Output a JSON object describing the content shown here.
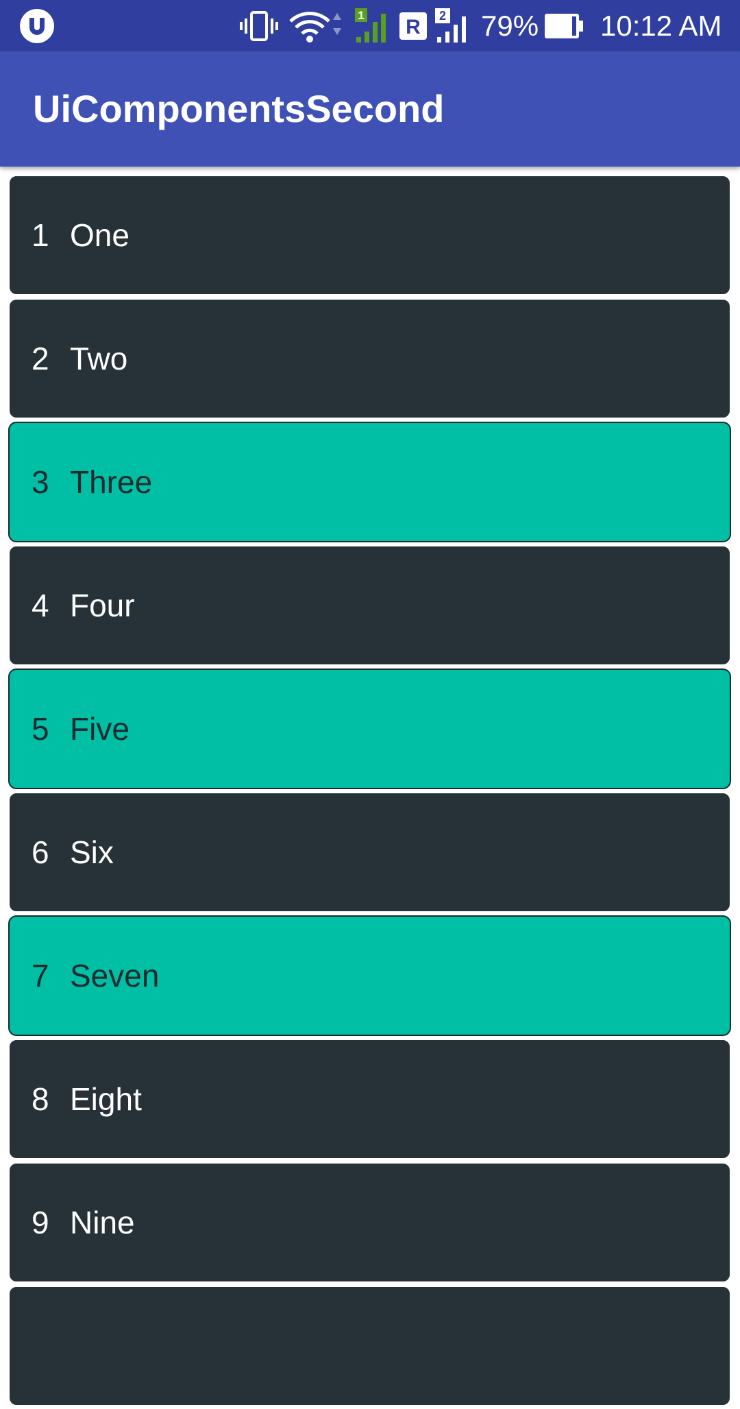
{
  "status_bar": {
    "battery_percent": "79%",
    "time": "10:12 AM",
    "sim1_label": "1",
    "sim2_label": "2",
    "roaming_label": "R",
    "background_color": "#303f9f"
  },
  "app_bar": {
    "title": "UiComponentsSecond",
    "background_color": "#3f51b5"
  },
  "colors": {
    "item_dark": "#263238",
    "item_highlight": "#00bfa5"
  },
  "list": {
    "items": [
      {
        "number": "1",
        "label": "One",
        "style": "dark"
      },
      {
        "number": "2",
        "label": "Two",
        "style": "dark"
      },
      {
        "number": "3",
        "label": "Three",
        "style": "teal"
      },
      {
        "number": "4",
        "label": "Four",
        "style": "dark"
      },
      {
        "number": "5",
        "label": "Five",
        "style": "teal"
      },
      {
        "number": "6",
        "label": "Six",
        "style": "dark"
      },
      {
        "number": "7",
        "label": "Seven",
        "style": "teal"
      },
      {
        "number": "8",
        "label": "Eight",
        "style": "dark"
      },
      {
        "number": "9",
        "label": "Nine",
        "style": "dark"
      },
      {
        "number": "",
        "label": "",
        "style": "dark"
      }
    ]
  }
}
